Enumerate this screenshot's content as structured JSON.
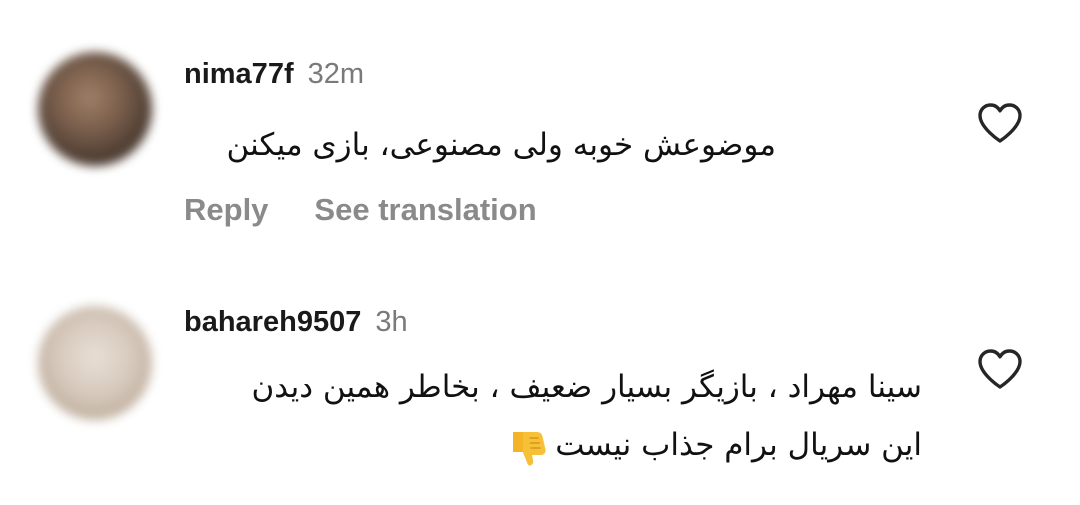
{
  "comments": [
    {
      "username": "nima77f",
      "time": "32m",
      "text_lines": [
        "موضوعش خوبه ولی مصنوعی، بازی میکنن"
      ],
      "actions": {
        "reply": "Reply",
        "translate": "See translation"
      }
    },
    {
      "username": "bahareh9507",
      "time": "3h",
      "text_lines": [
        "سینا مهراد ، بازیگر بسیار ضعیف ، بخاطر همین دیدن",
        "این سریال برام جذاب نیست"
      ],
      "emoji": "thumbs-down-icon"
    }
  ],
  "colors": {
    "username": "#1a1a1a",
    "muted": "#7a7a7a",
    "action": "#8a8a8a",
    "like_outline": "#262626"
  }
}
